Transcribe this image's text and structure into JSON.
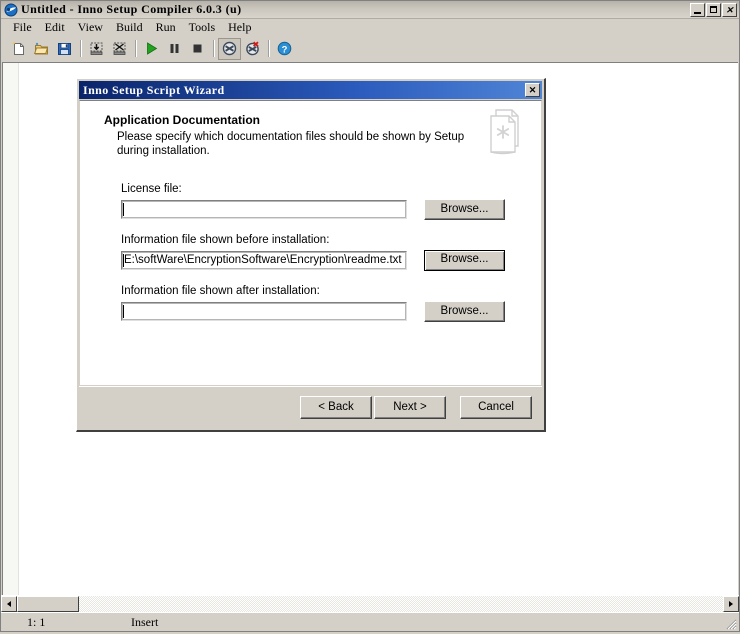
{
  "window": {
    "title": "Untitled - Inno Setup Compiler 6.0.3 (u)",
    "app_icon": "inno-setup-icon",
    "controls": {
      "minimize": "minimize-button",
      "maximize": "maximize-button",
      "close": "close-button",
      "close_glyph": "✕"
    }
  },
  "menu": {
    "items": [
      {
        "label": "File"
      },
      {
        "label": "Edit"
      },
      {
        "label": "View"
      },
      {
        "label": "Build"
      },
      {
        "label": "Run"
      },
      {
        "label": "Tools"
      },
      {
        "label": "Help"
      }
    ]
  },
  "toolbar": {
    "buttons": [
      {
        "name": "new-file-icon",
        "tip": "New"
      },
      {
        "name": "open-file-icon",
        "tip": "Open"
      },
      {
        "name": "save-file-icon",
        "tip": "Save"
      },
      {
        "name": "compile-icon",
        "tip": "Compile"
      },
      {
        "name": "compile-and-run-icon",
        "tip": "Compile and Run"
      },
      {
        "name": "run-icon",
        "tip": "Run"
      },
      {
        "name": "pause-icon",
        "tip": "Pause"
      },
      {
        "name": "stop-icon",
        "tip": "Stop"
      },
      {
        "name": "terminate-icon",
        "tip": "Terminate"
      },
      {
        "name": "terminate-cancel-icon",
        "tip": "Terminate and Cancel"
      },
      {
        "name": "help-icon",
        "tip": "Help"
      }
    ]
  },
  "editor": {
    "content": ""
  },
  "scrollbar": {
    "left_arrow": "scroll-left-arrow",
    "right_arrow": "scroll-right-arrow"
  },
  "status_bar": {
    "position": "1:   1",
    "mode": "Insert"
  },
  "dialog": {
    "title": "Inno Setup Script Wizard",
    "close_glyph": "✕",
    "header": {
      "title": "Application Documentation",
      "description": "Please specify which documentation files should be shown by Setup during installation.",
      "icon": "documentation-pages-icon"
    },
    "fields": [
      {
        "label": "License file:",
        "value": "",
        "placeholder": "",
        "browse_label": "Browse...",
        "focused": false,
        "caret": true,
        "name": "license-file"
      },
      {
        "label": "Information file shown before installation:",
        "value": "E:\\softWare\\EncryptionSoftware\\Encryption\\readme.txt",
        "placeholder": "",
        "browse_label": "Browse...",
        "focused": true,
        "caret": true,
        "name": "info-before-file"
      },
      {
        "label": "Information file shown after installation:",
        "value": "",
        "placeholder": "",
        "browse_label": "Browse...",
        "focused": false,
        "caret": true,
        "name": "info-after-file"
      }
    ],
    "buttons": {
      "back": "< Back",
      "next": "Next >",
      "cancel": "Cancel"
    }
  },
  "colors": {
    "face": "#d4d0c8",
    "dialog_title_start": "#0a246a",
    "dialog_title_end": "#4f85d6",
    "window_bg": "#ffffff",
    "run_green": "#22a31f",
    "help_blue": "#2a8fd4"
  }
}
